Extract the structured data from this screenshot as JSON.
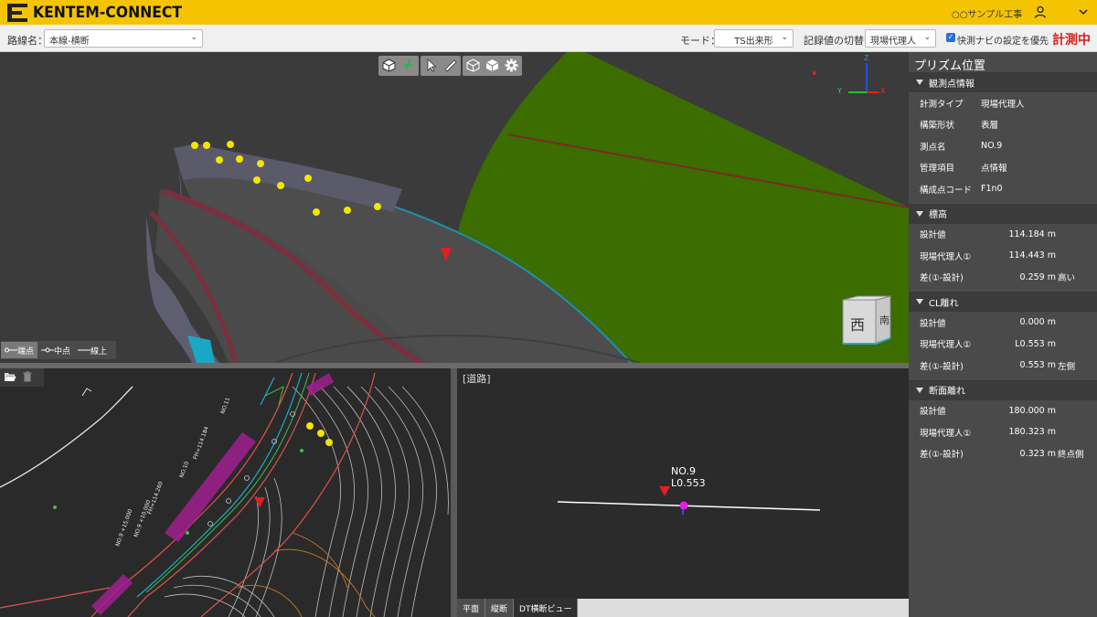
{
  "header": {
    "brand": "KENTEM-CONNECT",
    "project": "○○サンプル工事",
    "user_icon": "user-icon",
    "menu_icon": "chevron-down-icon"
  },
  "toolbar": {
    "route_label": "路線名：",
    "route_value": "本線-横断",
    "mode_label": "モード：",
    "mode_value": "TS出来形",
    "record_label": "記録値の切替：",
    "record_value": "現場代理人",
    "navi_check_label": "快測ナビの設定を優先",
    "navi_checked": true,
    "status": "計測中"
  },
  "view3d": {
    "tools": [
      "cube-view-icon",
      "walk-icon",
      "pointer-icon",
      "measure-icon",
      "wireframe-cube-icon",
      "solid-cube-icon",
      "gear-icon"
    ],
    "axes": {
      "z": "Z",
      "y": "Y",
      "x": "X"
    },
    "legend": [
      {
        "label": "端点",
        "active": true
      },
      {
        "label": "中点",
        "active": false
      },
      {
        "label": "線上",
        "active": false
      }
    ],
    "cube_faces": {
      "front": "西",
      "side": "南"
    }
  },
  "plan": {
    "tools": [
      "folder-open-icon",
      "trash-icon"
    ]
  },
  "cross": {
    "title": "[道路]",
    "point_name": "NO.9",
    "point_offset": "L0.553"
  },
  "tabs": [
    {
      "label": "平面",
      "active": false
    },
    {
      "label": "縦断",
      "active": false
    },
    {
      "label": "DT横断ビュー",
      "active": true
    }
  ],
  "panel": {
    "title": "プリズム位置",
    "sections": {
      "info": {
        "title": "観測点情報",
        "rows": [
          {
            "key": "計測タイプ",
            "value": "現場代理人"
          },
          {
            "key": "構築形状",
            "value": "表層"
          },
          {
            "key": "測点名",
            "value": "NO.9"
          },
          {
            "key": "管理項目",
            "value": "点情報"
          },
          {
            "key": "構成点コード",
            "value": "F1n0"
          }
        ]
      },
      "elevation": {
        "title": "標高",
        "rows": [
          {
            "key": "設計値",
            "value": "114.184 m",
            "flag": ""
          },
          {
            "key": "現場代理人①",
            "value": "114.443 m",
            "flag": ""
          },
          {
            "key": "差(①-設計)",
            "value": "0.259 m",
            "flag": "高い"
          }
        ]
      },
      "cl": {
        "title": "CL離れ",
        "rows": [
          {
            "key": "設計値",
            "value": "0.000 m",
            "flag": ""
          },
          {
            "key": "現場代理人①",
            "value": "L0.553 m",
            "flag": ""
          },
          {
            "key": "差(①-設計)",
            "value": "0.553 m",
            "flag": "左側"
          }
        ]
      },
      "section": {
        "title": "断面離れ",
        "rows": [
          {
            "key": "設計値",
            "value": "180.000 m",
            "flag": ""
          },
          {
            "key": "現場代理人①",
            "value": "180.323 m",
            "flag": ""
          },
          {
            "key": "差(①-設計)",
            "value": "0.323 m",
            "flag": "終点側"
          }
        ]
      }
    }
  },
  "colors": {
    "header_yellow": "#f5c400",
    "status_red": "#d8201a",
    "panel_bg": "#4a4a4a",
    "terrain_green": "#3a6a00"
  }
}
